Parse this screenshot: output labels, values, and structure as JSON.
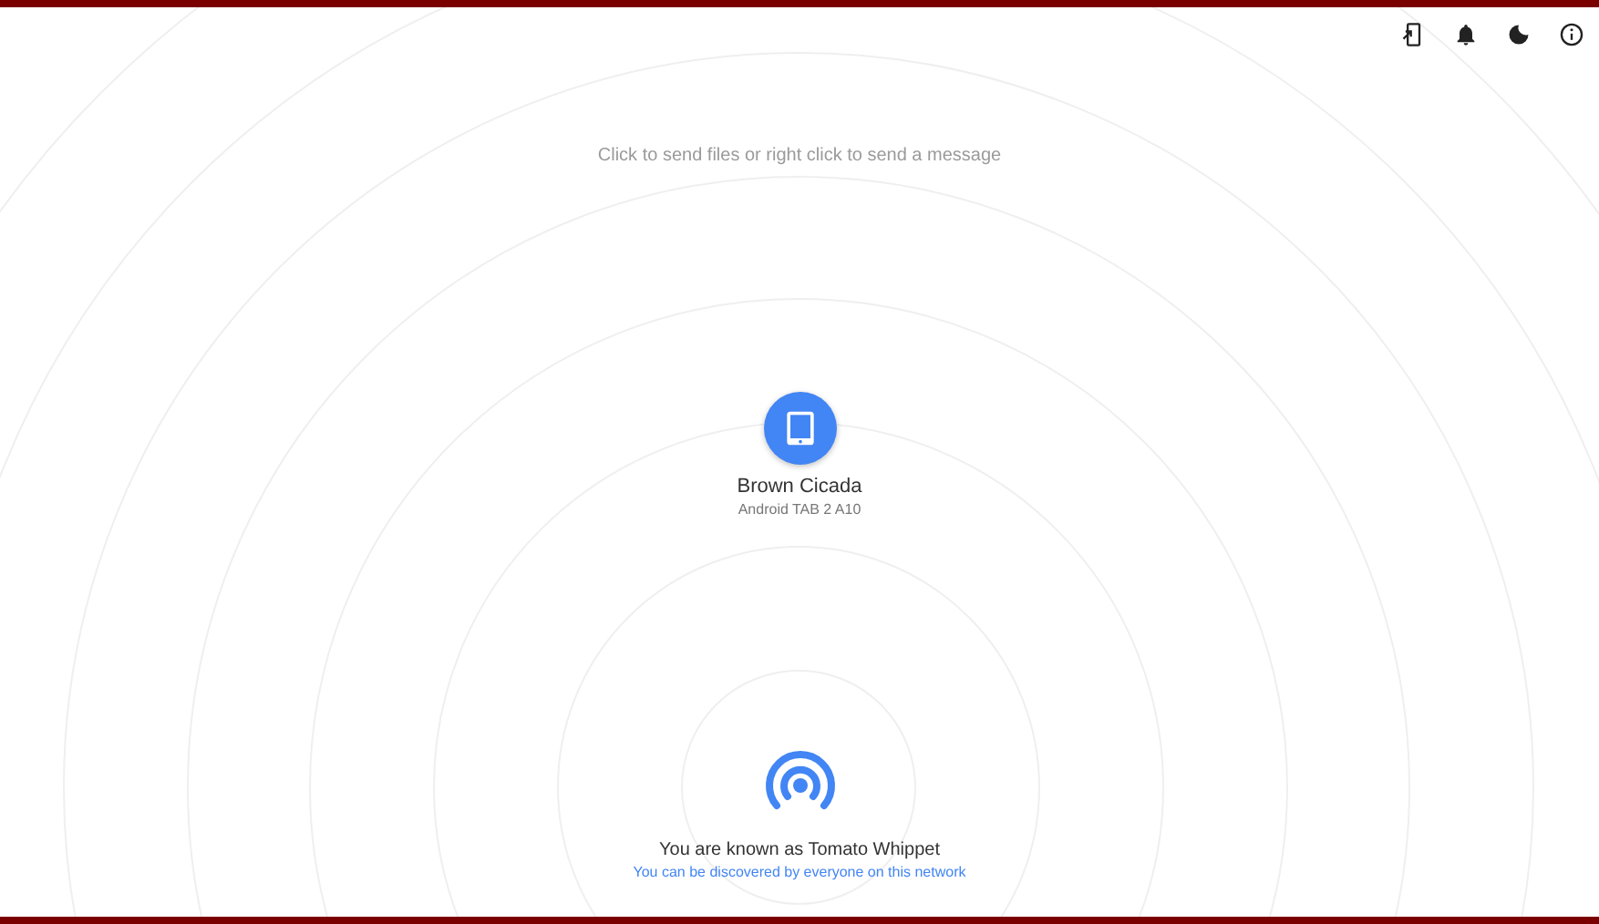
{
  "hint": "Click to send files or right click to send a message",
  "peers": [
    {
      "name": "Brown Cicada",
      "device": "Android TAB 2 A10"
    }
  ],
  "self": {
    "known_as": "You are known as Tomato Whippet",
    "discoverable": "You can be discovered by everyone on this network"
  }
}
